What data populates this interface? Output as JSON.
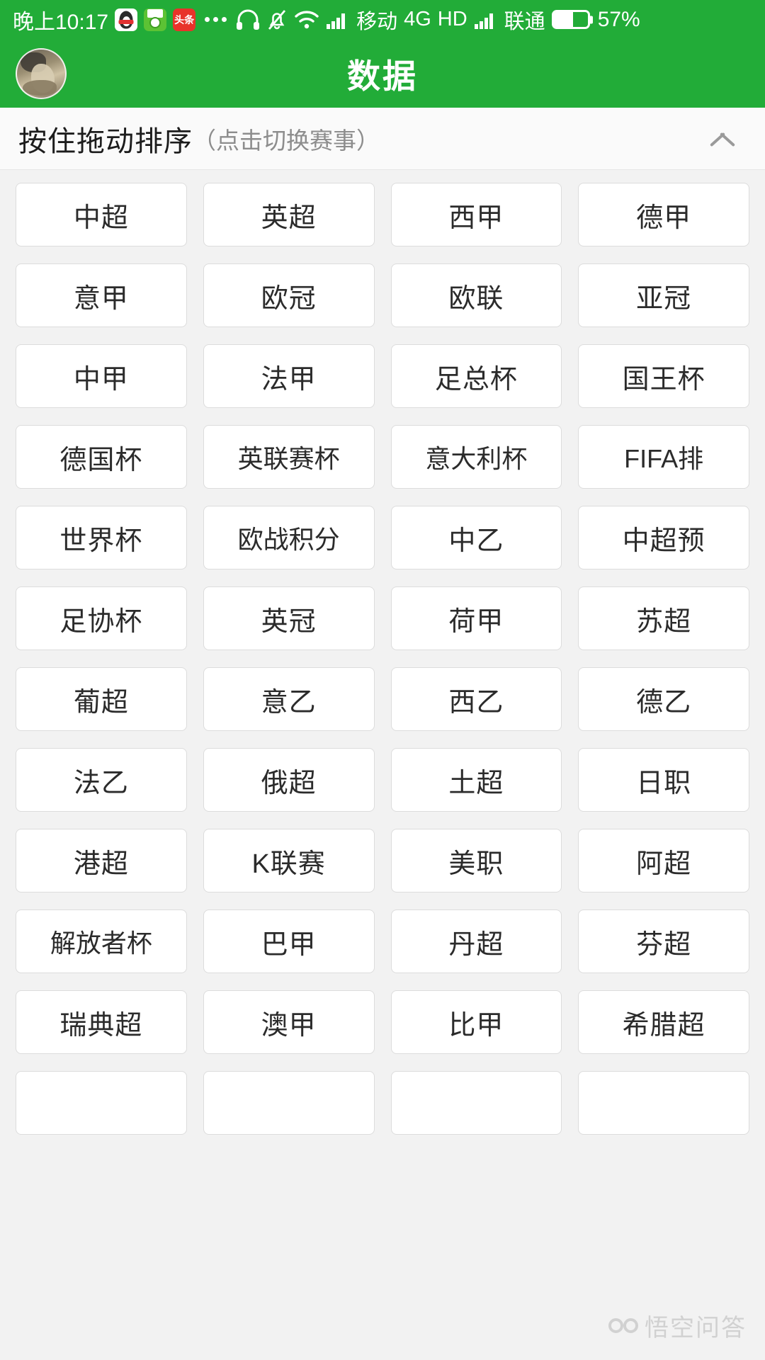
{
  "status_bar": {
    "clock": "晚上10:17",
    "app_icons": [
      {
        "name": "qq-icon",
        "label": "QQ"
      },
      {
        "name": "football-app-icon",
        "label": "球"
      },
      {
        "name": "toutiao-icon",
        "label": "头条"
      }
    ],
    "overflow": "...",
    "icons": [
      "headset-icon",
      "bell-muted-icon",
      "wifi-icon",
      "signal-icon"
    ],
    "carrier_1": "移动",
    "network_type": "4G",
    "hd_label": "HD",
    "carrier_2": "联通",
    "battery_percent": "57%",
    "battery_level": 57
  },
  "app_bar": {
    "title": "数据",
    "avatar_label": "用户头像"
  },
  "sub_bar": {
    "title_main": "按住拖动排序",
    "title_sub": "（点击切换赛事）",
    "collapse_icon": "chevron-up-icon"
  },
  "colors": {
    "brand_green": "#22ac38",
    "page_background": "#f2f2f2",
    "tile_background": "#ffffff",
    "tile_border": "#dcdcdc",
    "text_primary": "#2b2b2b",
    "text_muted": "#8d8d8d"
  },
  "league_grid": {
    "columns": 4,
    "tiles": [
      "中超",
      "英超",
      "西甲",
      "德甲",
      "意甲",
      "欧冠",
      "欧联",
      "亚冠",
      "中甲",
      "法甲",
      "足总杯",
      "国王杯",
      "德国杯",
      "英联赛杯",
      "意大利杯",
      "FIFA排",
      "世界杯",
      "欧战积分",
      "中乙",
      "中超预",
      "足协杯",
      "英冠",
      "荷甲",
      "苏超",
      "葡超",
      "意乙",
      "西乙",
      "德乙",
      "法乙",
      "俄超",
      "土超",
      "日职",
      "港超",
      "K联赛",
      "美职",
      "阿超",
      "解放者杯",
      "巴甲",
      "丹超",
      "芬超",
      "瑞典超",
      "澳甲",
      "比甲",
      "希腊超",
      "",
      "",
      "",
      ""
    ]
  },
  "watermark": {
    "text": "悟空问答"
  }
}
